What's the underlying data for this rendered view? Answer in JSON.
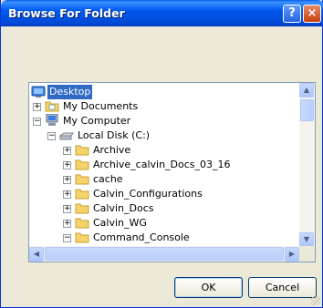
{
  "window": {
    "title": "Browse For Folder",
    "help_label": "?",
    "close_label": "×"
  },
  "tree": {
    "items": [
      {
        "label": "Desktop",
        "expander": "",
        "icon": "desktop-icon",
        "selected": true
      },
      {
        "label": "My Documents",
        "expander": "+",
        "icon": "my-documents-folder-icon"
      },
      {
        "label": "My Computer",
        "expander": "−",
        "icon": "my-computer-icon"
      },
      {
        "label": "Local Disk (C:)",
        "expander": "−",
        "icon": "local-disk-icon"
      },
      {
        "label": "Archive",
        "expander": "+",
        "icon": "folder-icon"
      },
      {
        "label": "Archive_calvin_Docs_03_16",
        "expander": "+",
        "icon": "folder-icon"
      },
      {
        "label": "cache",
        "expander": "+",
        "icon": "folder-icon"
      },
      {
        "label": "Calvin_Configurations",
        "expander": "+",
        "icon": "folder-icon"
      },
      {
        "label": "Calvin_Docs",
        "expander": "+",
        "icon": "folder-icon"
      },
      {
        "label": "Calvin_WG",
        "expander": "+",
        "icon": "folder-icon"
      },
      {
        "label": "Command_Console",
        "expander": "−",
        "icon": "folder-icon"
      }
    ]
  },
  "buttons": {
    "ok": "OK",
    "cancel": "Cancel"
  },
  "colors": {
    "titlebar": "#0058ee",
    "selection": "#316ac5",
    "folder": "#f5d36b",
    "dialog_bg": "#ece9d8"
  }
}
